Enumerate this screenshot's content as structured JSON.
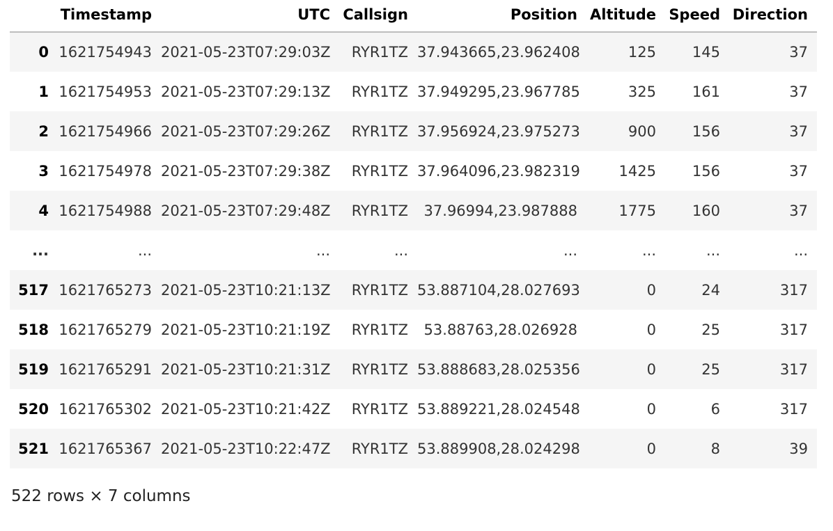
{
  "table": {
    "columns": [
      "",
      "Timestamp",
      "UTC",
      "Callsign",
      "Position",
      "Altitude",
      "Speed",
      "Direction"
    ],
    "rows": [
      [
        "0",
        "1621754943",
        "2021-05-23T07:29:03Z",
        "RYR1TZ",
        "37.943665,23.962408",
        "125",
        "145",
        "37"
      ],
      [
        "1",
        "1621754953",
        "2021-05-23T07:29:13Z",
        "RYR1TZ",
        "37.949295,23.967785",
        "325",
        "161",
        "37"
      ],
      [
        "2",
        "1621754966",
        "2021-05-23T07:29:26Z",
        "RYR1TZ",
        "37.956924,23.975273",
        "900",
        "156",
        "37"
      ],
      [
        "3",
        "1621754978",
        "2021-05-23T07:29:38Z",
        "RYR1TZ",
        "37.964096,23.982319",
        "1425",
        "156",
        "37"
      ],
      [
        "4",
        "1621754988",
        "2021-05-23T07:29:48Z",
        "RYR1TZ",
        "37.96994,23.987888",
        "1775",
        "160",
        "37"
      ],
      [
        "...",
        "...",
        "...",
        "...",
        "...",
        "...",
        "...",
        "..."
      ],
      [
        "517",
        "1621765273",
        "2021-05-23T10:21:13Z",
        "RYR1TZ",
        "53.887104,28.027693",
        "0",
        "24",
        "317"
      ],
      [
        "518",
        "1621765279",
        "2021-05-23T10:21:19Z",
        "RYR1TZ",
        "53.88763,28.026928",
        "0",
        "25",
        "317"
      ],
      [
        "519",
        "1621765291",
        "2021-05-23T10:21:31Z",
        "RYR1TZ",
        "53.888683,28.025356",
        "0",
        "25",
        "317"
      ],
      [
        "520",
        "1621765302",
        "2021-05-23T10:21:42Z",
        "RYR1TZ",
        "53.889221,28.024548",
        "0",
        "6",
        "317"
      ],
      [
        "521",
        "1621765367",
        "2021-05-23T10:22:47Z",
        "RYR1TZ",
        "53.889908,28.024298",
        "0",
        "8",
        "39"
      ]
    ]
  },
  "shape_text": "522 rows × 7 columns"
}
